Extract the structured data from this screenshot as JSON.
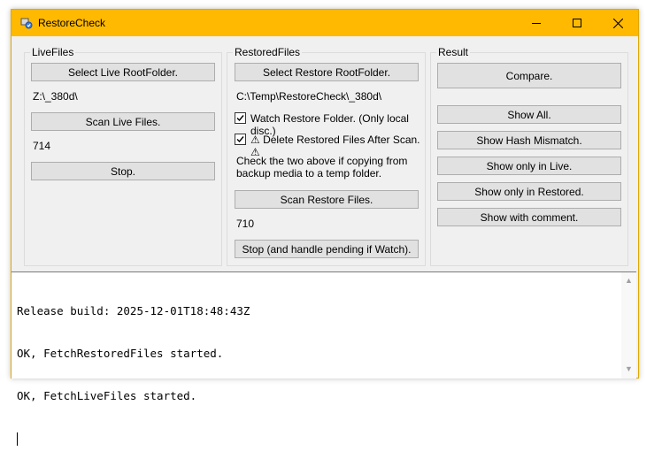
{
  "window": {
    "title": "RestoreCheck"
  },
  "live": {
    "group_title": "LiveFiles",
    "select_button": "Select Live RootFolder.",
    "path": "Z:\\_380d\\",
    "scan_button": "Scan Live Files.",
    "count": "714",
    "stop_button": "Stop."
  },
  "restored": {
    "group_title": "RestoredFiles",
    "select_button": "Select Restore RootFolder.",
    "path": "C:\\Temp\\RestoreCheck\\_380d\\",
    "watch_label": "Watch Restore Folder. (Only local disc.)",
    "watch_checked": true,
    "delete_label": "⚠ Delete Restored Files After Scan. ⚠",
    "delete_checked": true,
    "hint_line1": "Check the two above if copying from",
    "hint_line2": "backup media to a temp folder.",
    "scan_button": "Scan Restore Files.",
    "count": "710",
    "stop_button": "Stop (and handle pending if Watch)."
  },
  "result": {
    "group_title": "Result",
    "compare_button": "Compare.",
    "show_all": "Show All.",
    "show_hash_mismatch": "Show Hash Mismatch.",
    "show_only_live": "Show only in Live.",
    "show_only_restored": "Show only in Restored.",
    "show_with_comment": "Show with comment."
  },
  "log": {
    "lines": [
      "Release build: 2025-12-01T18:48:43Z",
      "OK, FetchRestoredFiles started.",
      "OK, FetchLiveFiles started."
    ]
  },
  "colors": {
    "titlebar": "#ffb900",
    "button": "#e1e1e1",
    "button_border": "#adadad",
    "window_bg": "#f0f0f0"
  }
}
